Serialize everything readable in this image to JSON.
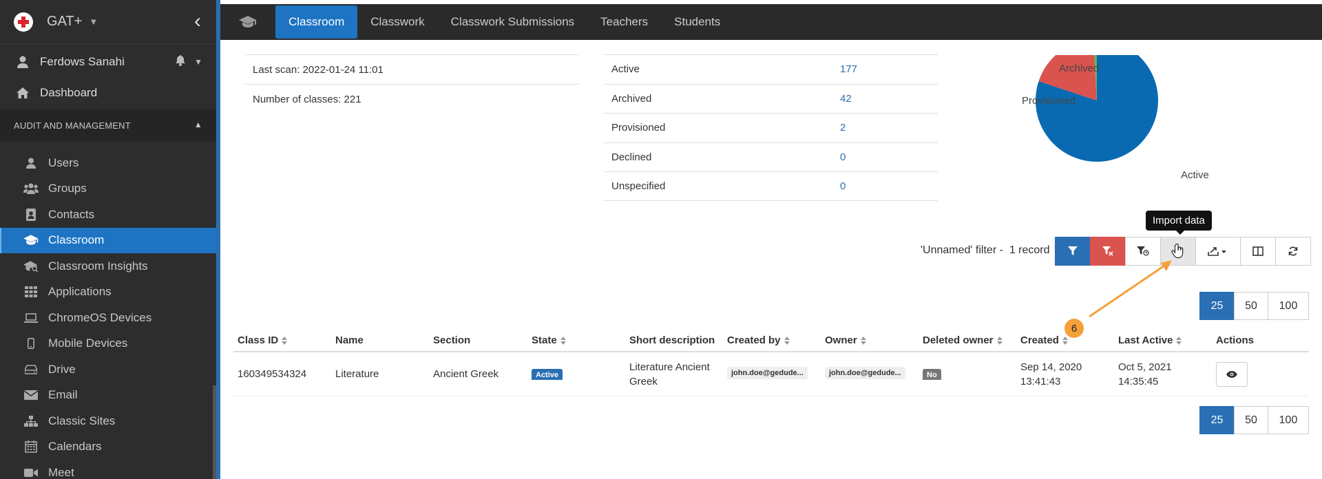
{
  "sidebar": {
    "brand": "GAT+",
    "user_name": "Ferdows Sanahi",
    "dashboard": "Dashboard",
    "section_title": "AUDIT AND MANAGEMENT",
    "items": [
      {
        "label": "Users",
        "icon": "user-icon"
      },
      {
        "label": "Groups",
        "icon": "groups-icon"
      },
      {
        "label": "Contacts",
        "icon": "contacts-icon"
      },
      {
        "label": "Classroom",
        "icon": "graduation-cap-icon",
        "active": true
      },
      {
        "label": "Classroom Insights",
        "icon": "classroom-insights-icon"
      },
      {
        "label": "Applications",
        "icon": "apps-grid-icon"
      },
      {
        "label": "ChromeOS Devices",
        "icon": "laptop-icon"
      },
      {
        "label": "Mobile Devices",
        "icon": "mobile-icon"
      },
      {
        "label": "Drive",
        "icon": "drive-icon"
      },
      {
        "label": "Email",
        "icon": "envelope-icon"
      },
      {
        "label": "Classic Sites",
        "icon": "sitemap-icon"
      },
      {
        "label": "Calendars",
        "icon": "calendar-icon"
      },
      {
        "label": "Meet",
        "icon": "video-camera-icon"
      }
    ]
  },
  "topnav": {
    "tabs": [
      {
        "label": "Classroom",
        "active": true
      },
      {
        "label": "Classwork"
      },
      {
        "label": "Classwork Submissions"
      },
      {
        "label": "Teachers"
      },
      {
        "label": "Students"
      }
    ]
  },
  "summary": {
    "last_scan": "Last scan: 2022-01-24 11:01",
    "num_classes": "Number of classes: 221"
  },
  "state_counts": [
    {
      "label": "Active",
      "value": "177"
    },
    {
      "label": "Archived",
      "value": "42"
    },
    {
      "label": "Provisioned",
      "value": "2"
    },
    {
      "label": "Declined",
      "value": "0"
    },
    {
      "label": "Unspecified",
      "value": "0"
    }
  ],
  "chart_data": {
    "type": "pie",
    "categories": [
      "Active",
      "Archived",
      "Provisioned"
    ],
    "values": [
      177,
      42,
      2
    ],
    "colors": [
      "#0a6ab1",
      "#d9534f",
      "#5cb85c"
    ]
  },
  "tooltip": "Import data",
  "filter": {
    "name": "'Unnamed' filter -",
    "count": "1 record"
  },
  "pagination": [
    "25",
    "50",
    "100"
  ],
  "table": {
    "headers": [
      "Class ID",
      "Name",
      "Section",
      "State",
      "Short description",
      "Created by",
      "Owner",
      "Deleted owner",
      "Created",
      "Last Active",
      "Actions"
    ],
    "row": {
      "class_id": "160349534324",
      "name": "Literature",
      "section": "Ancient Greek",
      "state": "Active",
      "short_description": "Literature Ancient Greek",
      "created_by": "john.doe@gedude...",
      "owner": "john.doe@gedude...",
      "deleted_owner": "No",
      "created": "Sep 14, 2020 13:41:43",
      "last_active": "Oct 5, 2021 14:35:45"
    }
  },
  "annotation": {
    "step": "6",
    "color": "#f5a03a"
  }
}
